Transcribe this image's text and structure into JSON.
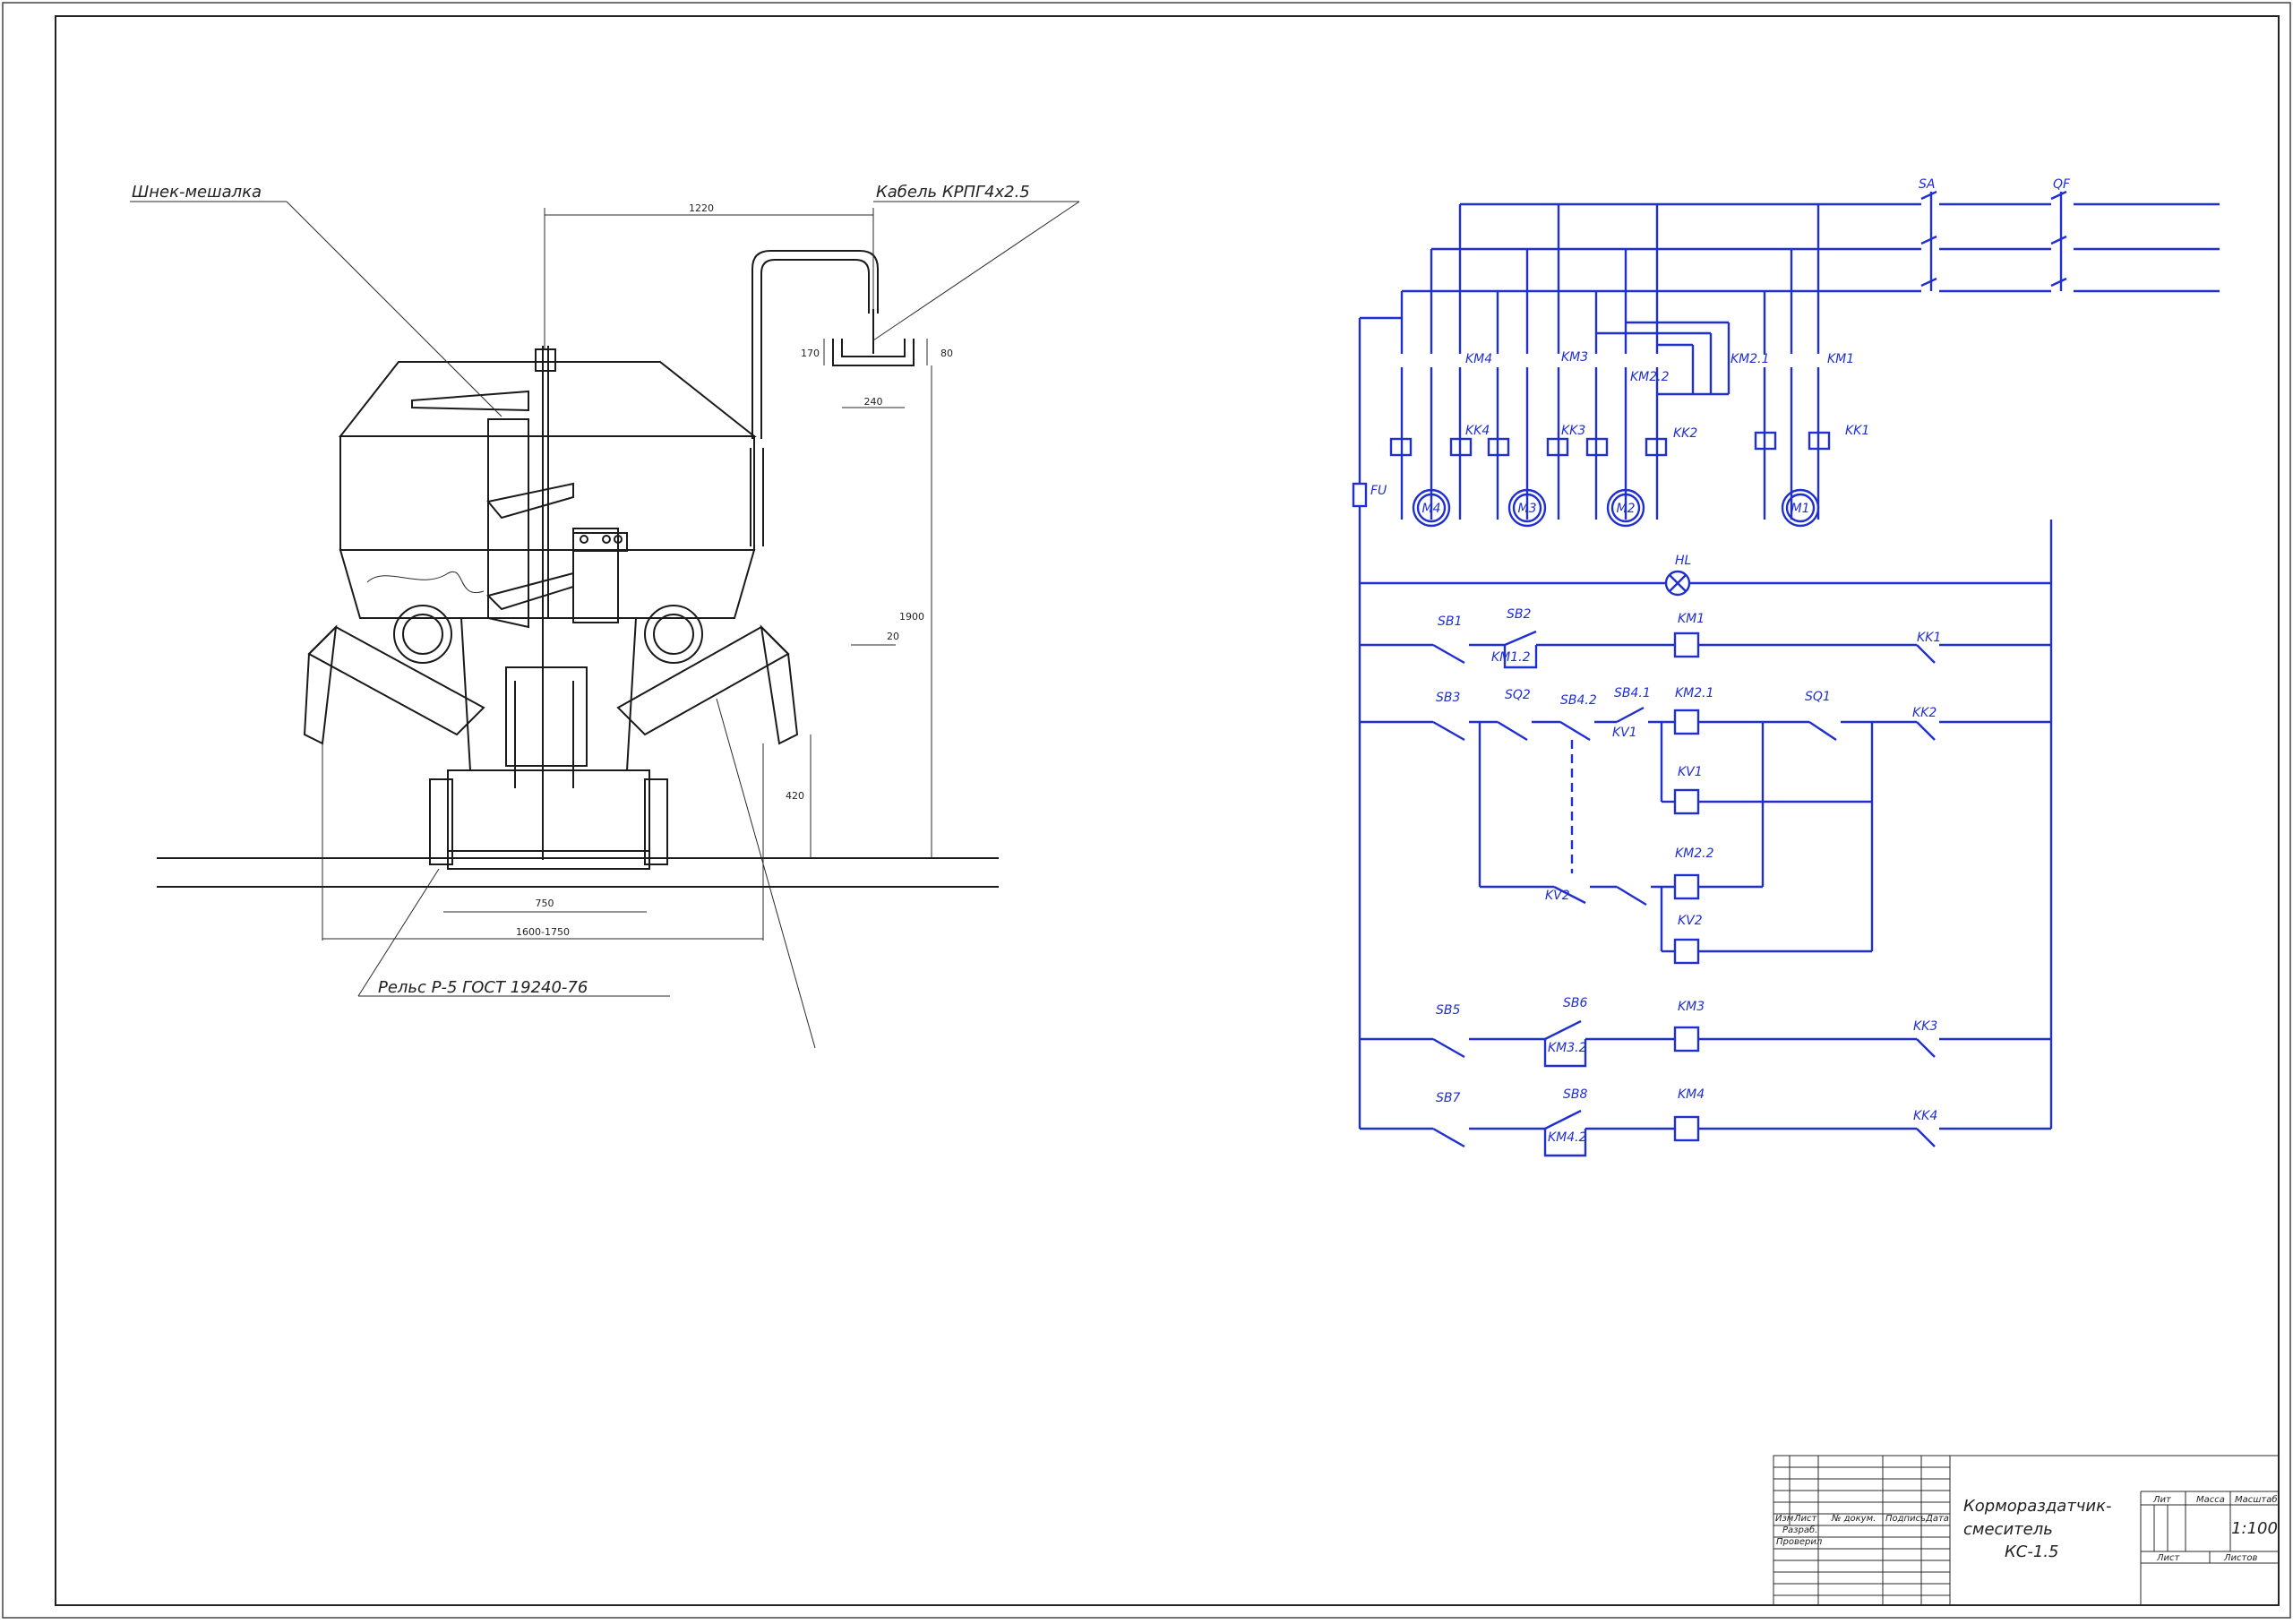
{
  "mechanical": {
    "callouts": {
      "auger": "Шнек-мешалка",
      "cable": "Кабель КРПГ4х2.5",
      "rail": "Рельс Р-5  ГОСТ 19240-76"
    },
    "dimensions": {
      "top_span": "1220",
      "pipe_height": "170",
      "trough_height": "80",
      "trough_width": "240",
      "total_height": "1900",
      "angle": "20",
      "axle_height": "420",
      "gauge": "750",
      "overall_width": "1600-1750"
    }
  },
  "schematic": {
    "switches": [
      "SA",
      "QF"
    ],
    "fuse": "FU",
    "lamp": "HL",
    "motors": [
      "M4",
      "M3",
      "M2",
      "M1"
    ],
    "contactors": [
      "KM4",
      "KM3",
      "KM2.1",
      "KM2.2",
      "KM1"
    ],
    "thermal": [
      "KK4",
      "KK3",
      "KK2",
      "KK1"
    ],
    "rung1": {
      "sb1": "SB1",
      "sb2": "SB2",
      "hold": "KM1.2",
      "coil": "KM1",
      "kk": "KK1"
    },
    "rung2": {
      "sb3": "SB3",
      "sq2": "SQ2",
      "sb42": "SB4.2",
      "sb41": "SB4.1",
      "kv1c": "KV1",
      "coil": "KM2.1",
      "sq1": "SQ1",
      "kk": "KK2"
    },
    "rung3": {
      "coil": "KV1"
    },
    "rung4": {
      "kv2c": "KV2",
      "coil": "KM2.2"
    },
    "rung5": {
      "coil": "KV2"
    },
    "rung6": {
      "sb5": "SB5",
      "sb6": "SB6",
      "hold": "KM3.2",
      "coil": "KM3",
      "kk": "KK3"
    },
    "rung7": {
      "sb7": "SB7",
      "sb8": "SB8",
      "hold": "KM4.2",
      "coil": "KM4",
      "kk": "KK4"
    }
  },
  "title_block": {
    "title_line1": "Кормораздатчик-",
    "title_line2": "смеситель",
    "title_line3": "КС-1.5",
    "col_izm": "Изм",
    "col_list": "Лист",
    "col_doc": "№ докум.",
    "col_sign": "Подпись",
    "col_date": "Дата",
    "row_dev": "Разраб.",
    "row_check": "Проверил",
    "lit": "Лит",
    "mass": "Масса",
    "scale_label": "Масштаб",
    "scale_value": "1:100",
    "sheet": "Лист",
    "sheets": "Листов"
  },
  "colors": {
    "schematic": "#1f2fd0",
    "mechanical": "#1a1a1a"
  }
}
